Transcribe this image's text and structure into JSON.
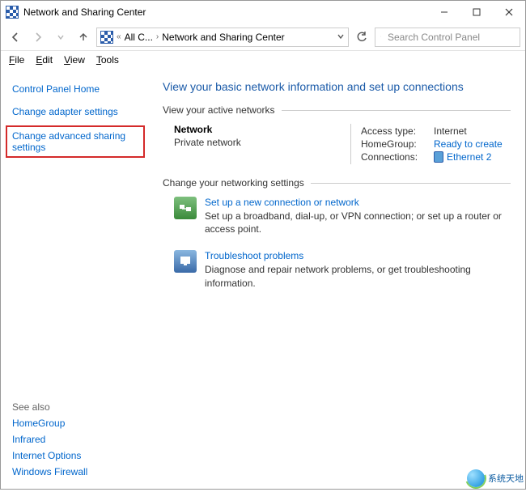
{
  "title": "Network and Sharing Center",
  "breadcrumb": {
    "seg1": "All C...",
    "seg2": "Network and Sharing Center"
  },
  "search_placeholder": "Search Control Panel",
  "menu": {
    "file": "File",
    "edit": "Edit",
    "view": "View",
    "tools": "Tools"
  },
  "sidebar": {
    "home": "Control Panel Home",
    "adapter": "Change adapter settings",
    "advanced": "Change advanced sharing settings"
  },
  "see_also": {
    "header": "See also",
    "items": [
      "HomeGroup",
      "Infrared",
      "Internet Options",
      "Windows Firewall"
    ]
  },
  "main": {
    "heading": "View your basic network information and set up connections",
    "active_hdr": "View your active networks",
    "network": {
      "name": "Network",
      "type": "Private network"
    },
    "props": {
      "access_k": "Access type:",
      "access_v": "Internet",
      "hg_k": "HomeGroup:",
      "hg_v": "Ready to create",
      "conn_k": "Connections:",
      "conn_v": "Ethernet 2"
    },
    "change_hdr": "Change your networking settings",
    "opt1_t": "Set up a new connection or network",
    "opt1_d": "Set up a broadband, dial-up, or VPN connection; or set up a router or access point.",
    "opt2_t": "Troubleshoot problems",
    "opt2_d": "Diagnose and repair network problems, or get troubleshooting information."
  },
  "watermark": "系统天地"
}
